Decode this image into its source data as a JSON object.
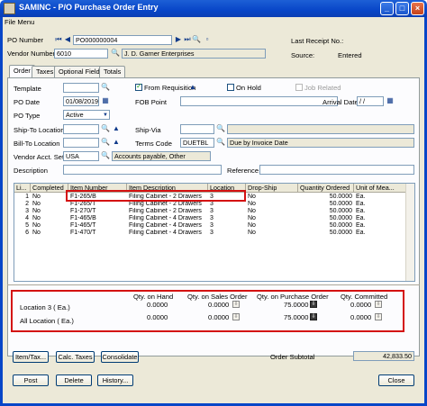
{
  "window": {
    "title": "SAMINC - P/O Purchase Order Entry"
  },
  "menu": {
    "file": "File  Menu"
  },
  "header": {
    "po_number_label": "PO Number",
    "po_number": "PO000000004",
    "vendor_label": "Vendor Number",
    "vendor_number": "6010",
    "vendor_name": "J. D. Garner Enterprises",
    "last_receipt_label": "Last Receipt No.:",
    "source_label": "Source:",
    "source_value": "Entered"
  },
  "tabs": [
    "Order",
    "Taxes",
    "Optional Fields",
    "Totals"
  ],
  "form": {
    "template_label": "Template",
    "from_requisition_label": "From Requisition",
    "on_hold_label": "On Hold",
    "job_related_label": "Job Related",
    "po_date_label": "PO Date",
    "po_date": "01/08/2019",
    "fob_label": "FOB Point",
    "arrival_label": "Arrival Date",
    "arrival_value": "/  /",
    "po_type_label": "PO Type",
    "po_type": "Active",
    "ship_to_label": "Ship-To Location",
    "ship_via_label": "Ship-Via",
    "bill_to_label": "Bill-To Location",
    "terms_label": "Terms Code",
    "terms_code": "DUETBL",
    "terms_desc": "Due by Invoice Date",
    "vendor_acct_label": "Vendor Acct. Set",
    "vendor_acct": "USA",
    "vendor_acct_desc": "Accounts payable, Other",
    "description_label": "Description",
    "reference_label": "Reference"
  },
  "grid": {
    "columns": [
      "Li...",
      "Completed",
      "Item Number",
      "Item Description",
      "Location",
      "Drop-Ship",
      "Quantity Ordered",
      "Unit of Mea..."
    ],
    "rows": [
      [
        "1",
        "No",
        "F1-265/B",
        "Filing Cabinet - 2 Drawers",
        "3",
        "No",
        "50.0000",
        "Ea."
      ],
      [
        "2",
        "No",
        "F1-265/T",
        "Filing Cabinet - 2 Drawers",
        "3",
        "No",
        "50.0000",
        "Ea."
      ],
      [
        "3",
        "No",
        "F1-270/T",
        "Filing Cabinet - 2 Drawers",
        "3",
        "No",
        "50.0000",
        "Ea."
      ],
      [
        "4",
        "No",
        "F1-465/B",
        "Filing Cabinet - 4 Drawers",
        "3",
        "No",
        "50.0000",
        "Ea."
      ],
      [
        "5",
        "No",
        "F1-465/T",
        "Filing Cabinet - 4 Drawers",
        "3",
        "No",
        "50.0000",
        "Ea."
      ],
      [
        "6",
        "No",
        "F1-470/T",
        "Filing Cabinet - 4 Drawers",
        "3",
        "No",
        "50.0000",
        "Ea."
      ]
    ]
  },
  "qty": {
    "on_hand_label": "Qty. on Hand",
    "on_sales_label": "Qty. on Sales Order",
    "on_po_label": "Qty. on Purchase Order",
    "committed_label": "Qty. Committed",
    "location_label": "Location 3 ( Ea.)",
    "all_label": "All Location  ( Ea.)",
    "loc_on_hand": "0.0000",
    "loc_on_sales": "0.0000",
    "loc_on_po": "75.0000",
    "loc_committed": "0.0000",
    "all_on_hand": "0.0000",
    "all_on_sales": "0.0000",
    "all_on_po": "75.0000",
    "all_committed": "0.0000"
  },
  "buttons": {
    "item_tax": "Item/Tax...",
    "calc_taxes": "Calc. Taxes",
    "consolidate": "Consolidate",
    "post": "Post",
    "delete": "Delete",
    "history": "History...",
    "close": "Close"
  },
  "subtotal": {
    "label": "Order Subtotal",
    "value": "42,833.50"
  },
  "colors": {
    "highlight": "#d41111",
    "title_bar": "#0846c8"
  }
}
